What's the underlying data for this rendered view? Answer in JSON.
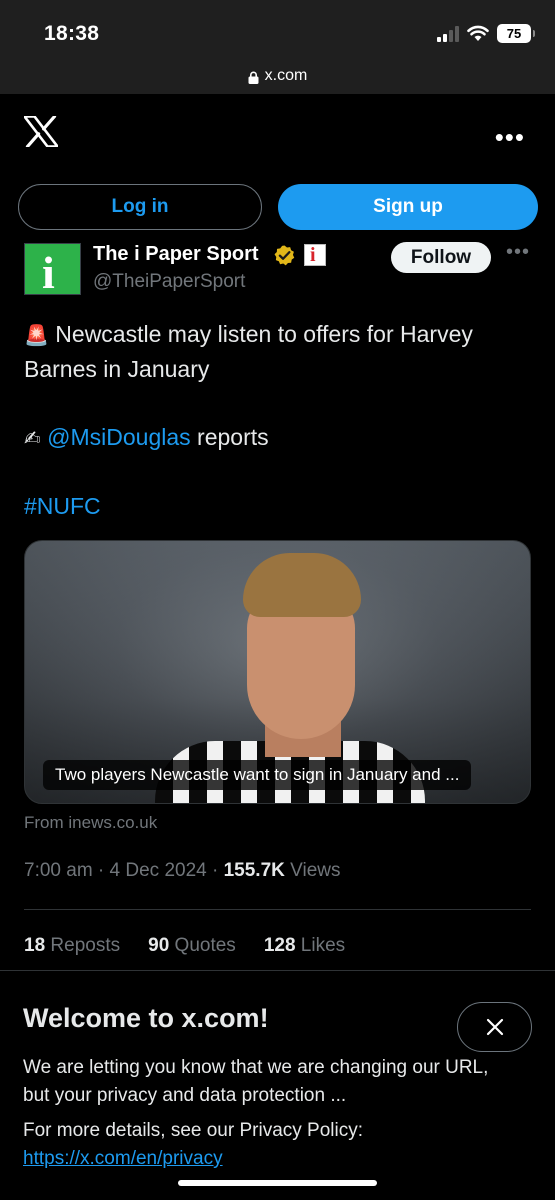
{
  "status_bar": {
    "time": "18:38",
    "battery": "75"
  },
  "browser": {
    "url": "x.com"
  },
  "auth": {
    "login_label": "Log in",
    "signup_label": "Sign up"
  },
  "tweet": {
    "author_name": "The i Paper Sport",
    "author_handle": "@TheiPaperSport",
    "avatar_letter": "i",
    "org_badge_letter": "i",
    "follow_label": "Follow",
    "text_line1": "Newcastle may listen to offers for Harvey",
    "text_line2": "Barnes in January",
    "mention": "@MsiDouglas",
    "reports_word": " reports",
    "hashtag": "#NUFC",
    "emoji_siren": "🚨",
    "emoji_writing": "✍",
    "media_caption": "Two players Newcastle want to sign in January and ...",
    "source": "From inews.co.uk",
    "timestamp": "7:00 am · 4 Dec 2024 · ",
    "views_count": "155.7K",
    "views_label": " Views",
    "reposts_count": "18",
    "reposts_label": " Reposts",
    "quotes_count": "90",
    "quotes_label": " Quotes",
    "likes_count": "128",
    "likes_label": " Likes"
  },
  "banner": {
    "title": "Welcome to x.com!",
    "body": "We are letting you know that we are changing our URL, but your privacy and data protection ...",
    "details": "For more details, see our Privacy Policy:",
    "link": "https://x.com/en/privacy"
  },
  "colors": {
    "accent": "#1d9bf0",
    "verified": "#e2b719",
    "avatar_bg": "#2db24a"
  }
}
